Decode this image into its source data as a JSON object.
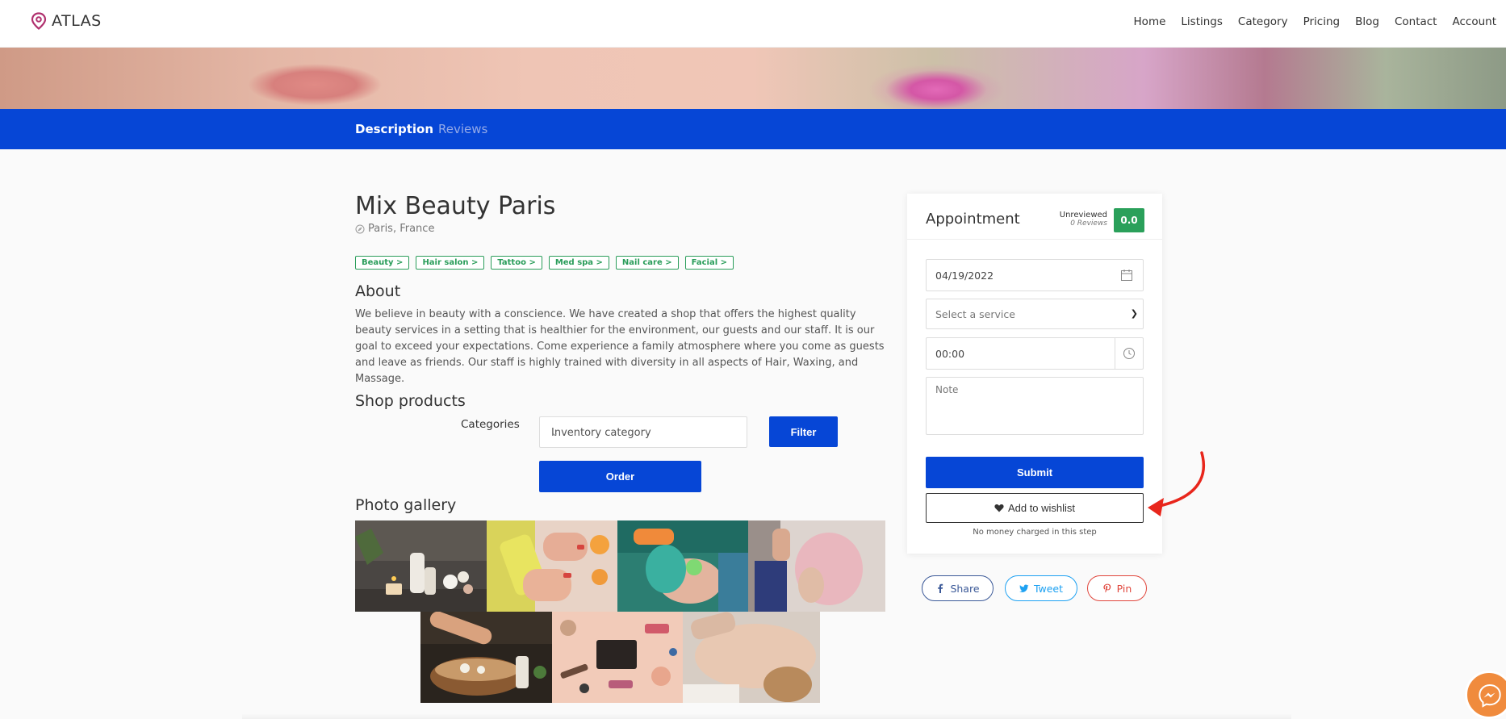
{
  "nav": {
    "logo_text": "ATLAS",
    "items": [
      "Home",
      "Listings",
      "Category",
      "Pricing",
      "Blog",
      "Contact",
      "Account"
    ]
  },
  "tabs": {
    "description": "Description",
    "reviews": "Reviews"
  },
  "listing": {
    "title": "Mix Beauty Paris",
    "location": "Paris, France",
    "tags": [
      "Beauty >",
      "Hair salon >",
      "Tattoo >",
      "Med spa >",
      "Nail care >",
      "Facial >"
    ],
    "about_heading": "About",
    "about_text": "We believe in beauty with a conscience. We have created a shop that offers the highest quality beauty services in a setting that is healthier for the environment, our guests and our staff. It is our goal to exceed your expectations. Come experience a family atmosphere where you come as guests and leave as friends. Our staff is highly trained with diversity in all aspects of Hair, Waxing, and Massage."
  },
  "shop": {
    "heading": "Shop products",
    "categories_label": "Categories",
    "category_select_value": "Inventory category",
    "filter_label": "Filter",
    "order_label": "Order"
  },
  "gallery": {
    "heading": "Photo gallery",
    "photos": [
      "spa-candles-photo",
      "manicure-photo",
      "facial-treatment-photo",
      "hair-styling-photo",
      "foot-spa-bowl-photo",
      "makeup-flatlay-photo",
      "back-massage-photo"
    ]
  },
  "appointment": {
    "title": "Appointment",
    "review_status": "Unreviewed",
    "review_count": "0 Reviews",
    "score": "0.0",
    "date_value": "04/19/2022",
    "service_placeholder": "Select a service",
    "time_value": "00:00",
    "note_placeholder": "Note",
    "submit_label": "Submit",
    "wishlist_label": "Add to wishlist",
    "note_text": "No money charged in this step"
  },
  "share": {
    "facebook": "Share",
    "twitter": "Tweet",
    "pinterest": "Pin"
  },
  "colors": {
    "primary": "#0646d6",
    "tag_green": "#2a9d5a",
    "score_green": "#2aa05a",
    "annotation_arrow": "#e8261c",
    "logo_pin": "#b0306e"
  }
}
